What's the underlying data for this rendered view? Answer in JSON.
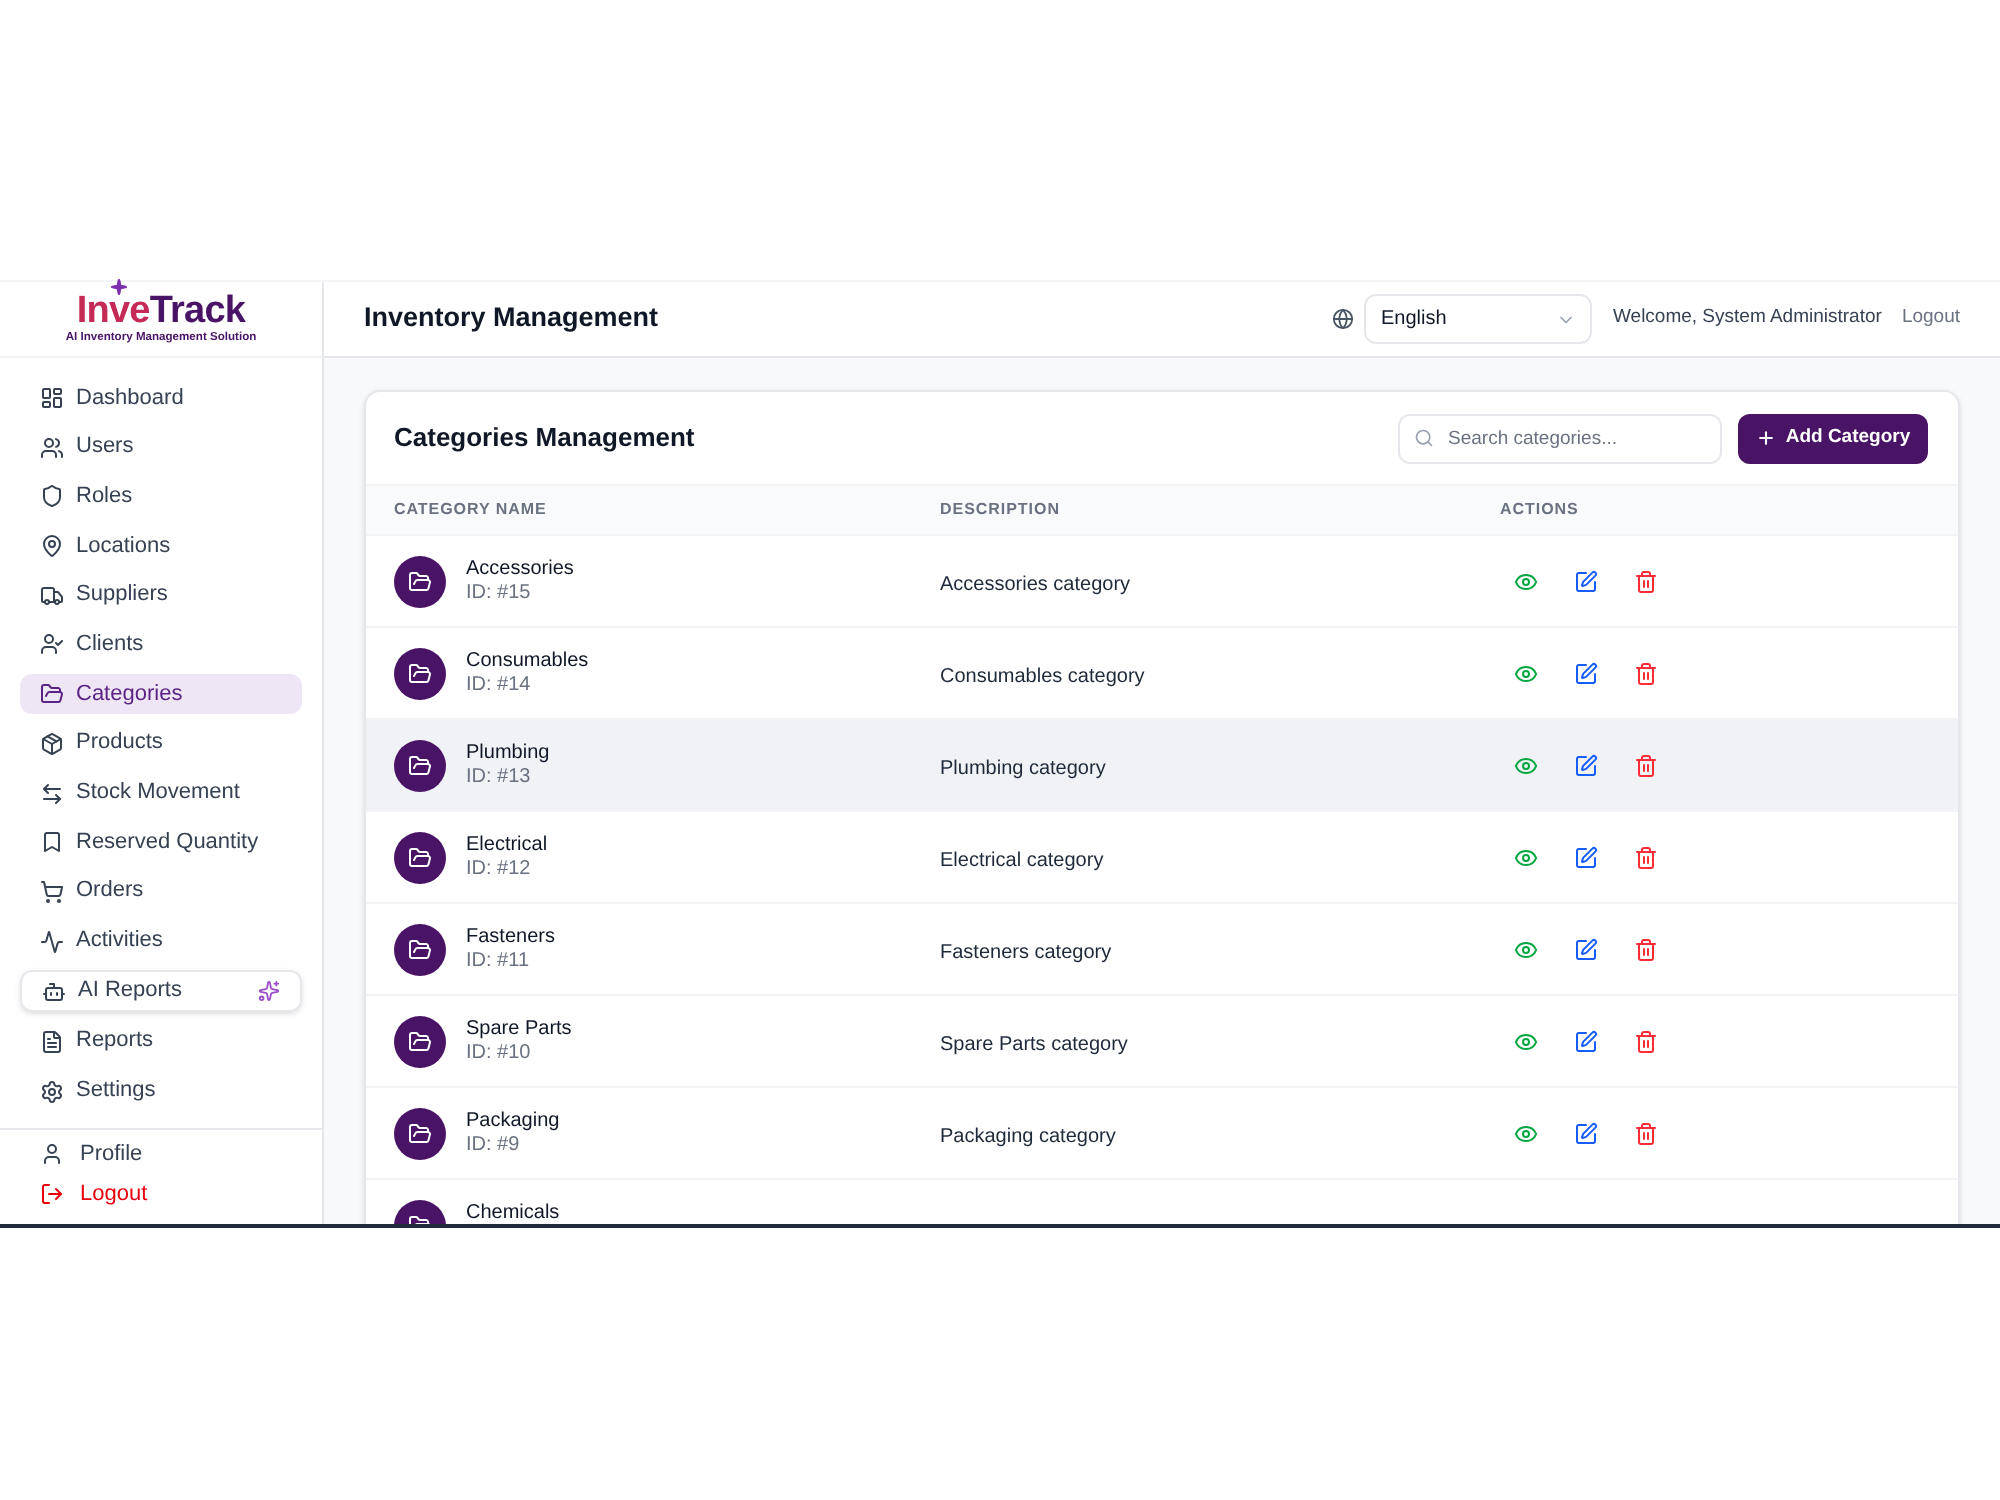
{
  "logo": {
    "name_start": "Inve",
    "name_end": "Track",
    "tagline": "AI Inventory Management Solution"
  },
  "sidebar": {
    "items": [
      {
        "label": "Dashboard",
        "selected": false,
        "kind": "link"
      },
      {
        "label": "Users",
        "selected": false,
        "kind": "link"
      },
      {
        "label": "Roles",
        "selected": false,
        "kind": "link"
      },
      {
        "label": "Locations",
        "selected": false,
        "kind": "link"
      },
      {
        "label": "Suppliers",
        "selected": false,
        "kind": "link"
      },
      {
        "label": "Clients",
        "selected": false,
        "kind": "link"
      },
      {
        "label": "Categories",
        "selected": true,
        "kind": "link"
      },
      {
        "label": "Products",
        "selected": false,
        "kind": "link"
      },
      {
        "label": "Stock Movement",
        "selected": false,
        "kind": "link"
      },
      {
        "label": "Reserved Quantity",
        "selected": false,
        "kind": "link"
      },
      {
        "label": "Orders",
        "selected": false,
        "kind": "link"
      },
      {
        "label": "Activities",
        "selected": false,
        "kind": "link"
      },
      {
        "label": "AI Reports",
        "selected": false,
        "kind": "ai"
      },
      {
        "label": "Reports",
        "selected": false,
        "kind": "link"
      },
      {
        "label": "Settings",
        "selected": false,
        "kind": "link"
      }
    ],
    "footer": [
      {
        "label": "Profile",
        "kind": "account"
      },
      {
        "label": "Logout",
        "kind": "danger"
      }
    ]
  },
  "header": {
    "title": "Inventory Management",
    "language": "English",
    "welcome": "Welcome, System Administrator",
    "logout": "Logout"
  },
  "categories": {
    "title": "Categories Management",
    "search": {
      "placeholder": "Search categories..."
    },
    "add_button": "Add Category",
    "table": {
      "columns": [
        "CATEGORY NAME",
        "DESCRIPTION",
        "ACTIONS"
      ],
      "rows": [
        {
          "name": "Accessories",
          "id": "ID: #15",
          "description": "Accessories category",
          "hovered": false,
          "actions": [
            {
              "kind": "view"
            },
            {
              "kind": "edit"
            },
            {
              "kind": "delete"
            }
          ]
        },
        {
          "name": "Consumables",
          "id": "ID: #14",
          "description": "Consumables category",
          "hovered": false,
          "actions": [
            {
              "kind": "view"
            },
            {
              "kind": "edit"
            },
            {
              "kind": "delete"
            }
          ]
        },
        {
          "name": "Plumbing",
          "id": "ID: #13",
          "description": "Plumbing category",
          "hovered": true,
          "actions": [
            {
              "kind": "view"
            },
            {
              "kind": "edit"
            },
            {
              "kind": "delete"
            }
          ]
        },
        {
          "name": "Electrical",
          "id": "ID: #12",
          "description": "Electrical category",
          "hovered": false,
          "actions": [
            {
              "kind": "view"
            },
            {
              "kind": "edit"
            },
            {
              "kind": "delete"
            }
          ]
        },
        {
          "name": "Fasteners",
          "id": "ID: #11",
          "description": "Fasteners category",
          "hovered": false,
          "actions": [
            {
              "kind": "view"
            },
            {
              "kind": "edit"
            },
            {
              "kind": "delete"
            }
          ]
        },
        {
          "name": "Spare Parts",
          "id": "ID: #10",
          "description": "Spare Parts category",
          "hovered": false,
          "actions": [
            {
              "kind": "view"
            },
            {
              "kind": "edit"
            },
            {
              "kind": "delete"
            }
          ]
        },
        {
          "name": "Packaging",
          "id": "ID: #9",
          "description": "Packaging category",
          "hovered": false,
          "actions": [
            {
              "kind": "view"
            },
            {
              "kind": "edit"
            },
            {
              "kind": "delete"
            }
          ]
        },
        {
          "name": "Chemicals",
          "hovered": false
        }
      ]
    }
  }
}
